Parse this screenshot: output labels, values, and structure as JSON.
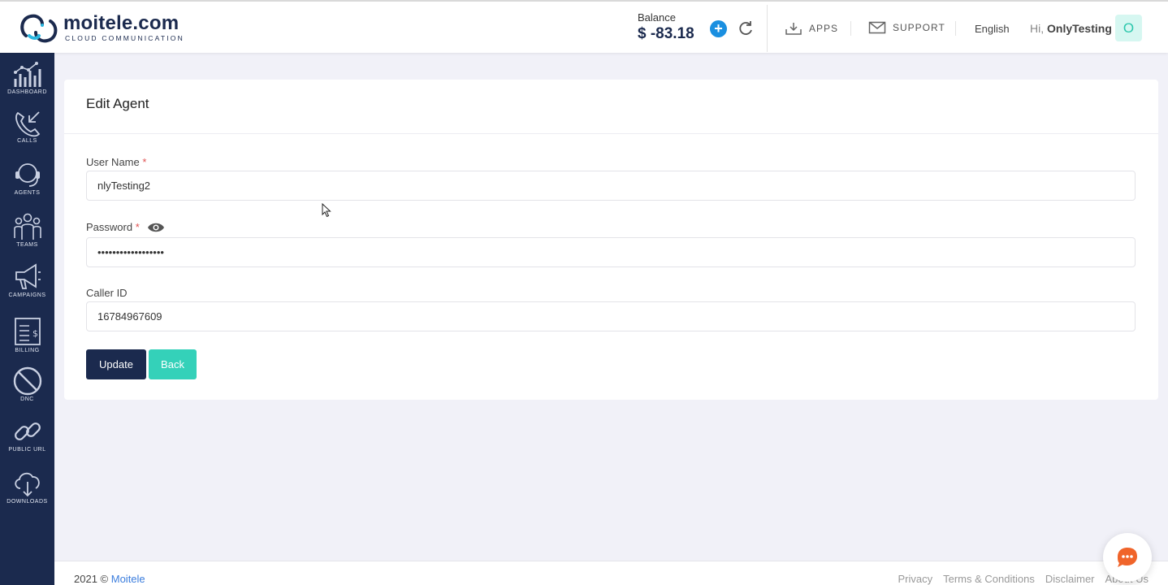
{
  "header": {
    "logo": {
      "name": "moitele.com",
      "tagline": "CLOUD COMMUNICATION"
    },
    "balance": {
      "label": "Balance",
      "value": "$ -83.18"
    },
    "add_label": "+",
    "apps_label": "APPS",
    "support_label": "SUPPORT",
    "language": "English",
    "greeting": "Hi,",
    "user_name": "OnlyTesting",
    "avatar_initial": "O"
  },
  "sidebar": {
    "items": [
      {
        "label": "DASHBOARD",
        "icon": "dashboard-icon"
      },
      {
        "label": "CALLS",
        "icon": "phone-icon"
      },
      {
        "label": "AGENTS",
        "icon": "headset-icon"
      },
      {
        "label": "TEAMS",
        "icon": "team-icon"
      },
      {
        "label": "CAMPAIGNS",
        "icon": "megaphone-icon"
      },
      {
        "label": "BILLING",
        "icon": "billing-icon"
      },
      {
        "label": "DNC",
        "icon": "no-entry-icon"
      },
      {
        "label": "PUBLIC URL",
        "icon": "link-icon"
      },
      {
        "label": "DOWNLOADS",
        "icon": "cloud-download-icon"
      }
    ]
  },
  "form": {
    "title": "Edit Agent",
    "username": {
      "label": "User Name",
      "required": "*",
      "value": "nlyTesting2"
    },
    "password": {
      "label": "Password",
      "required": "*",
      "value": "••••••••••••••••••"
    },
    "caller_id": {
      "label": "Caller ID",
      "value": "16784967609"
    },
    "update_label": "Update",
    "back_label": "Back"
  },
  "footer": {
    "year": "2021 ©",
    "brand": "Moitele",
    "links": [
      "Privacy",
      "Terms & Conditions",
      "Disclaimer",
      "About Us"
    ]
  },
  "colors": {
    "navy": "#1b2a4e",
    "teal": "#34d1b9",
    "accent_blue": "#1a8fe0",
    "chat_orange": "#f0642a"
  }
}
